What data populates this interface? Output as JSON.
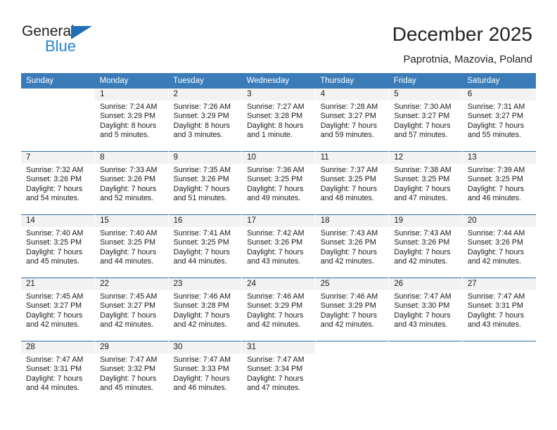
{
  "brand": {
    "name_top": "General",
    "name_bottom": "Blue",
    "triangle_color": "#1f6fb5",
    "blue_text_color": "#2585d3"
  },
  "header": {
    "title": "December 2025",
    "subtitle": "Paprotnia, Mazovia, Poland",
    "header_bar_color": "#3b7cb8",
    "daynum_band_color": "#f2f2f2",
    "week_separator_color": "#2e6ca4"
  },
  "weekdays": [
    "Sunday",
    "Monday",
    "Tuesday",
    "Wednesday",
    "Thursday",
    "Friday",
    "Saturday"
  ],
  "weeks": [
    [
      {
        "day": "",
        "sunrise": "",
        "sunset": "",
        "daylight_line1": "",
        "daylight_line2": ""
      },
      {
        "day": "1",
        "sunrise": "Sunrise: 7:24 AM",
        "sunset": "Sunset: 3:29 PM",
        "daylight_line1": "Daylight: 8 hours",
        "daylight_line2": "and 5 minutes."
      },
      {
        "day": "2",
        "sunrise": "Sunrise: 7:26 AM",
        "sunset": "Sunset: 3:29 PM",
        "daylight_line1": "Daylight: 8 hours",
        "daylight_line2": "and 3 minutes."
      },
      {
        "day": "3",
        "sunrise": "Sunrise: 7:27 AM",
        "sunset": "Sunset: 3:28 PM",
        "daylight_line1": "Daylight: 8 hours",
        "daylight_line2": "and 1 minute."
      },
      {
        "day": "4",
        "sunrise": "Sunrise: 7:28 AM",
        "sunset": "Sunset: 3:27 PM",
        "daylight_line1": "Daylight: 7 hours",
        "daylight_line2": "and 59 minutes."
      },
      {
        "day": "5",
        "sunrise": "Sunrise: 7:30 AM",
        "sunset": "Sunset: 3:27 PM",
        "daylight_line1": "Daylight: 7 hours",
        "daylight_line2": "and 57 minutes."
      },
      {
        "day": "6",
        "sunrise": "Sunrise: 7:31 AM",
        "sunset": "Sunset: 3:27 PM",
        "daylight_line1": "Daylight: 7 hours",
        "daylight_line2": "and 55 minutes."
      }
    ],
    [
      {
        "day": "7",
        "sunrise": "Sunrise: 7:32 AM",
        "sunset": "Sunset: 3:26 PM",
        "daylight_line1": "Daylight: 7 hours",
        "daylight_line2": "and 54 minutes."
      },
      {
        "day": "8",
        "sunrise": "Sunrise: 7:33 AM",
        "sunset": "Sunset: 3:26 PM",
        "daylight_line1": "Daylight: 7 hours",
        "daylight_line2": "and 52 minutes."
      },
      {
        "day": "9",
        "sunrise": "Sunrise: 7:35 AM",
        "sunset": "Sunset: 3:26 PM",
        "daylight_line1": "Daylight: 7 hours",
        "daylight_line2": "and 51 minutes."
      },
      {
        "day": "10",
        "sunrise": "Sunrise: 7:36 AM",
        "sunset": "Sunset: 3:25 PM",
        "daylight_line1": "Daylight: 7 hours",
        "daylight_line2": "and 49 minutes."
      },
      {
        "day": "11",
        "sunrise": "Sunrise: 7:37 AM",
        "sunset": "Sunset: 3:25 PM",
        "daylight_line1": "Daylight: 7 hours",
        "daylight_line2": "and 48 minutes."
      },
      {
        "day": "12",
        "sunrise": "Sunrise: 7:38 AM",
        "sunset": "Sunset: 3:25 PM",
        "daylight_line1": "Daylight: 7 hours",
        "daylight_line2": "and 47 minutes."
      },
      {
        "day": "13",
        "sunrise": "Sunrise: 7:39 AM",
        "sunset": "Sunset: 3:25 PM",
        "daylight_line1": "Daylight: 7 hours",
        "daylight_line2": "and 46 minutes."
      }
    ],
    [
      {
        "day": "14",
        "sunrise": "Sunrise: 7:40 AM",
        "sunset": "Sunset: 3:25 PM",
        "daylight_line1": "Daylight: 7 hours",
        "daylight_line2": "and 45 minutes."
      },
      {
        "day": "15",
        "sunrise": "Sunrise: 7:40 AM",
        "sunset": "Sunset: 3:25 PM",
        "daylight_line1": "Daylight: 7 hours",
        "daylight_line2": "and 44 minutes."
      },
      {
        "day": "16",
        "sunrise": "Sunrise: 7:41 AM",
        "sunset": "Sunset: 3:25 PM",
        "daylight_line1": "Daylight: 7 hours",
        "daylight_line2": "and 44 minutes."
      },
      {
        "day": "17",
        "sunrise": "Sunrise: 7:42 AM",
        "sunset": "Sunset: 3:26 PM",
        "daylight_line1": "Daylight: 7 hours",
        "daylight_line2": "and 43 minutes."
      },
      {
        "day": "18",
        "sunrise": "Sunrise: 7:43 AM",
        "sunset": "Sunset: 3:26 PM",
        "daylight_line1": "Daylight: 7 hours",
        "daylight_line2": "and 42 minutes."
      },
      {
        "day": "19",
        "sunrise": "Sunrise: 7:43 AM",
        "sunset": "Sunset: 3:26 PM",
        "daylight_line1": "Daylight: 7 hours",
        "daylight_line2": "and 42 minutes."
      },
      {
        "day": "20",
        "sunrise": "Sunrise: 7:44 AM",
        "sunset": "Sunset: 3:26 PM",
        "daylight_line1": "Daylight: 7 hours",
        "daylight_line2": "and 42 minutes."
      }
    ],
    [
      {
        "day": "21",
        "sunrise": "Sunrise: 7:45 AM",
        "sunset": "Sunset: 3:27 PM",
        "daylight_line1": "Daylight: 7 hours",
        "daylight_line2": "and 42 minutes."
      },
      {
        "day": "22",
        "sunrise": "Sunrise: 7:45 AM",
        "sunset": "Sunset: 3:27 PM",
        "daylight_line1": "Daylight: 7 hours",
        "daylight_line2": "and 42 minutes."
      },
      {
        "day": "23",
        "sunrise": "Sunrise: 7:46 AM",
        "sunset": "Sunset: 3:28 PM",
        "daylight_line1": "Daylight: 7 hours",
        "daylight_line2": "and 42 minutes."
      },
      {
        "day": "24",
        "sunrise": "Sunrise: 7:46 AM",
        "sunset": "Sunset: 3:29 PM",
        "daylight_line1": "Daylight: 7 hours",
        "daylight_line2": "and 42 minutes."
      },
      {
        "day": "25",
        "sunrise": "Sunrise: 7:46 AM",
        "sunset": "Sunset: 3:29 PM",
        "daylight_line1": "Daylight: 7 hours",
        "daylight_line2": "and 42 minutes."
      },
      {
        "day": "26",
        "sunrise": "Sunrise: 7:47 AM",
        "sunset": "Sunset: 3:30 PM",
        "daylight_line1": "Daylight: 7 hours",
        "daylight_line2": "and 43 minutes."
      },
      {
        "day": "27",
        "sunrise": "Sunrise: 7:47 AM",
        "sunset": "Sunset: 3:31 PM",
        "daylight_line1": "Daylight: 7 hours",
        "daylight_line2": "and 43 minutes."
      }
    ],
    [
      {
        "day": "28",
        "sunrise": "Sunrise: 7:47 AM",
        "sunset": "Sunset: 3:31 PM",
        "daylight_line1": "Daylight: 7 hours",
        "daylight_line2": "and 44 minutes."
      },
      {
        "day": "29",
        "sunrise": "Sunrise: 7:47 AM",
        "sunset": "Sunset: 3:32 PM",
        "daylight_line1": "Daylight: 7 hours",
        "daylight_line2": "and 45 minutes."
      },
      {
        "day": "30",
        "sunrise": "Sunrise: 7:47 AM",
        "sunset": "Sunset: 3:33 PM",
        "daylight_line1": "Daylight: 7 hours",
        "daylight_line2": "and 46 minutes."
      },
      {
        "day": "31",
        "sunrise": "Sunrise: 7:47 AM",
        "sunset": "Sunset: 3:34 PM",
        "daylight_line1": "Daylight: 7 hours",
        "daylight_line2": "and 47 minutes."
      },
      {
        "day": "",
        "sunrise": "",
        "sunset": "",
        "daylight_line1": "",
        "daylight_line2": ""
      },
      {
        "day": "",
        "sunrise": "",
        "sunset": "",
        "daylight_line1": "",
        "daylight_line2": ""
      },
      {
        "day": "",
        "sunrise": "",
        "sunset": "",
        "daylight_line1": "",
        "daylight_line2": ""
      }
    ]
  ]
}
